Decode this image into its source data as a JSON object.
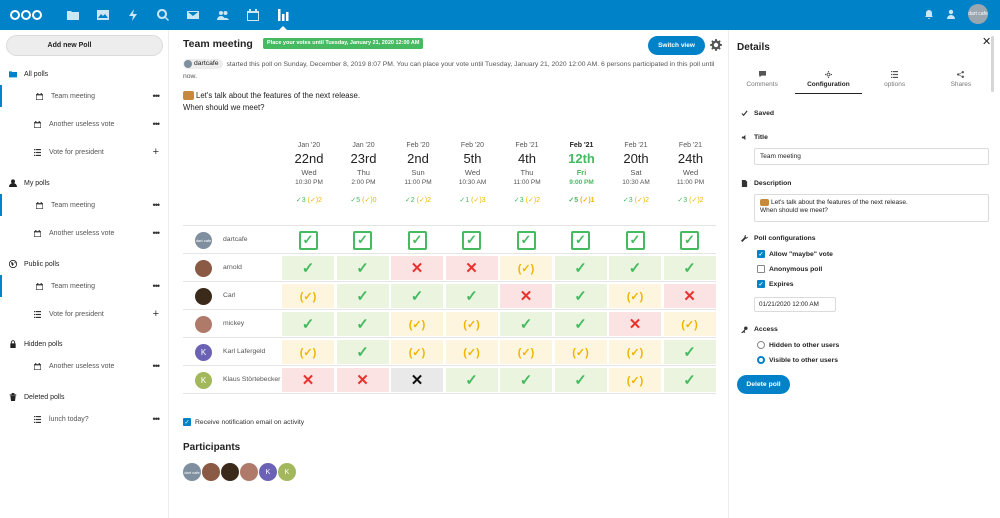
{
  "header": {
    "apps": [
      "files-icon",
      "photos-icon",
      "activity-icon",
      "search-icon",
      "mail-icon",
      "contacts-icon",
      "calendar-icon",
      "polls-icon"
    ],
    "avatar_text": "dart cafe"
  },
  "sidebar": {
    "new_poll": "Add new Poll",
    "all_polls": {
      "label": "All polls",
      "items": [
        {
          "label": "Team meeting",
          "icon": "calendar-icon",
          "action": "•••",
          "selected": true
        },
        {
          "label": "Another useless vote",
          "icon": "calendar-icon",
          "action": "•••"
        },
        {
          "label": "Vote for president",
          "icon": "list-icon",
          "action": "+"
        }
      ]
    },
    "my_polls": {
      "label": "My polls",
      "items": [
        {
          "label": "Team meeting",
          "icon": "calendar-icon",
          "action": "•••",
          "selected": true
        },
        {
          "label": "Another useless vote",
          "icon": "calendar-icon",
          "action": "•••"
        }
      ]
    },
    "public_polls": {
      "label": "Public polls",
      "items": [
        {
          "label": "Team meeting",
          "icon": "calendar-icon",
          "action": "•••",
          "selected": true
        },
        {
          "label": "Vote for president",
          "icon": "list-icon",
          "action": "+"
        }
      ]
    },
    "hidden_polls": {
      "label": "Hidden polls",
      "items": [
        {
          "label": "Another useless vote",
          "icon": "calendar-icon",
          "action": "•••"
        }
      ]
    },
    "deleted_polls": {
      "label": "Deleted polls",
      "items": [
        {
          "label": "lunch today?",
          "icon": "list-icon",
          "action": "•••"
        }
      ]
    }
  },
  "poll": {
    "title": "Team meeting",
    "deadline_badge": "Place your votes until Tuesday, January 21, 2020 12:00 AM",
    "switch_view": "Switch view",
    "owner": "dartcafe",
    "info": "started this poll on Sunday, December 8, 2019 8:07 PM. You can place your vote until Tuesday, January 21, 2020 12:00 AM. 6 persons participated in this poll until now.",
    "desc_line1": "Let's talk about the features of the next release.",
    "desc_line2": "When should we meet?",
    "notify_label": "Receive notification email on activity",
    "participants_title": "Participants"
  },
  "dates": [
    {
      "month": "Jan '20",
      "day": "22nd",
      "weekday": "Wed",
      "time": "10:30 PM",
      "yes": "✓3",
      "maybe": "(✓)2"
    },
    {
      "month": "Jan '20",
      "day": "23rd",
      "weekday": "Thu",
      "time": "2:00 PM",
      "yes": "✓5",
      "maybe": "(✓)0"
    },
    {
      "month": "Feb '20",
      "day": "2nd",
      "weekday": "Sun",
      "time": "11:00 PM",
      "yes": "✓2",
      "maybe": "(✓)2"
    },
    {
      "month": "Feb '20",
      "day": "5th",
      "weekday": "Wed",
      "time": "10:30 AM",
      "yes": "✓1",
      "maybe": "(✓)3"
    },
    {
      "month": "Feb '21",
      "day": "4th",
      "weekday": "Thu",
      "time": "11:00 PM",
      "yes": "✓3",
      "maybe": "(✓)2"
    },
    {
      "month": "Feb '21",
      "day": "12th",
      "weekday": "Fri",
      "time": "9:00 PM",
      "yes": "✓5",
      "maybe": "(✓)1",
      "confirmed": true
    },
    {
      "month": "Feb '21",
      "day": "20th",
      "weekday": "Sat",
      "time": "10:30 AM",
      "yes": "✓3",
      "maybe": "(✓)2"
    },
    {
      "month": "Feb '21",
      "day": "24th",
      "weekday": "Wed",
      "time": "11:00 PM",
      "yes": "✓3",
      "maybe": "(✓)2"
    }
  ],
  "participants": [
    {
      "name": "dartcafe",
      "initials": "dart cafe",
      "color": "#7f8fa0",
      "own": true,
      "votes": [
        "own",
        "own",
        "own",
        "own",
        "own",
        "own",
        "own",
        "own"
      ]
    },
    {
      "name": "arnold",
      "initials": "",
      "color": "#8a5a44",
      "votes": [
        "yes",
        "yes",
        "no",
        "no",
        "maybe",
        "yes",
        "yes",
        "yes"
      ]
    },
    {
      "name": "Carl",
      "initials": "",
      "color": "#3b2a1a",
      "votes": [
        "maybe",
        "yes",
        "yes",
        "yes",
        "no",
        "yes",
        "maybe",
        "no"
      ]
    },
    {
      "name": "mickey",
      "initials": "",
      "color": "#b07a6a",
      "votes": [
        "yes",
        "yes",
        "maybe",
        "maybe",
        "yes",
        "yes",
        "no",
        "maybe"
      ]
    },
    {
      "name": "Karl Lafergeld",
      "initials": "K",
      "color": "#6b62b6",
      "votes": [
        "maybe",
        "yes",
        "maybe",
        "maybe",
        "maybe",
        "maybe",
        "maybe",
        "yes"
      ]
    },
    {
      "name": "Klaus Störtebecker",
      "initials": "K",
      "color": "#a3b85c",
      "votes": [
        "no",
        "no",
        "none",
        "yes",
        "yes",
        "yes",
        "maybe",
        "yes"
      ]
    }
  ],
  "glyphs": {
    "yes": "✓",
    "no": "✕",
    "maybe": "(✓)",
    "none": "✕",
    "own": "✓"
  },
  "details": {
    "title": "Details",
    "close": "✕",
    "tabs": [
      {
        "label": "Comments",
        "icon": "comment-icon"
      },
      {
        "label": "Configuration",
        "icon": "gear-icon",
        "active": true
      },
      {
        "label": "options",
        "icon": "list-icon"
      },
      {
        "label": "Shares",
        "icon": "share-icon"
      }
    ],
    "saved": "Saved",
    "title_label": "Title",
    "title_value": "Team meeting",
    "description_label": "Description",
    "description_line1": "Let's talk about the features of the next release.",
    "description_line2": "When should we meet?",
    "config_label": "Poll configurations",
    "allow_maybe": "Allow \"maybe\" vote",
    "anonymous": "Anonymous poll",
    "expires": "Expires",
    "expiry_value": "01/21/2020 12:00 AM",
    "access_label": "Access",
    "hidden": "Hidden to other users",
    "visible": "Visible to other users",
    "delete": "Delete poll"
  }
}
